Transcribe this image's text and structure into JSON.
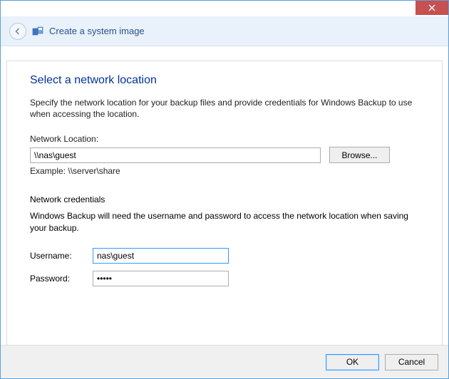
{
  "header": {
    "title": "Create a system image"
  },
  "main": {
    "heading": "Select a network location",
    "description": "Specify the network location for your backup files and provide credentials for Windows Backup to use when accessing the location.",
    "network_location_label": "Network Location:",
    "network_location_value": "\\\\nas\\guest",
    "browse_label": "Browse...",
    "example_text": "Example: \\\\server\\share",
    "credentials_heading": "Network credentials",
    "credentials_description": "Windows Backup will need the username and password to access the network location when saving your backup.",
    "username_label": "Username:",
    "username_value": "nas\\guest",
    "password_label": "Password:",
    "password_value": "•••••"
  },
  "footer": {
    "ok_label": "OK",
    "cancel_label": "Cancel"
  }
}
